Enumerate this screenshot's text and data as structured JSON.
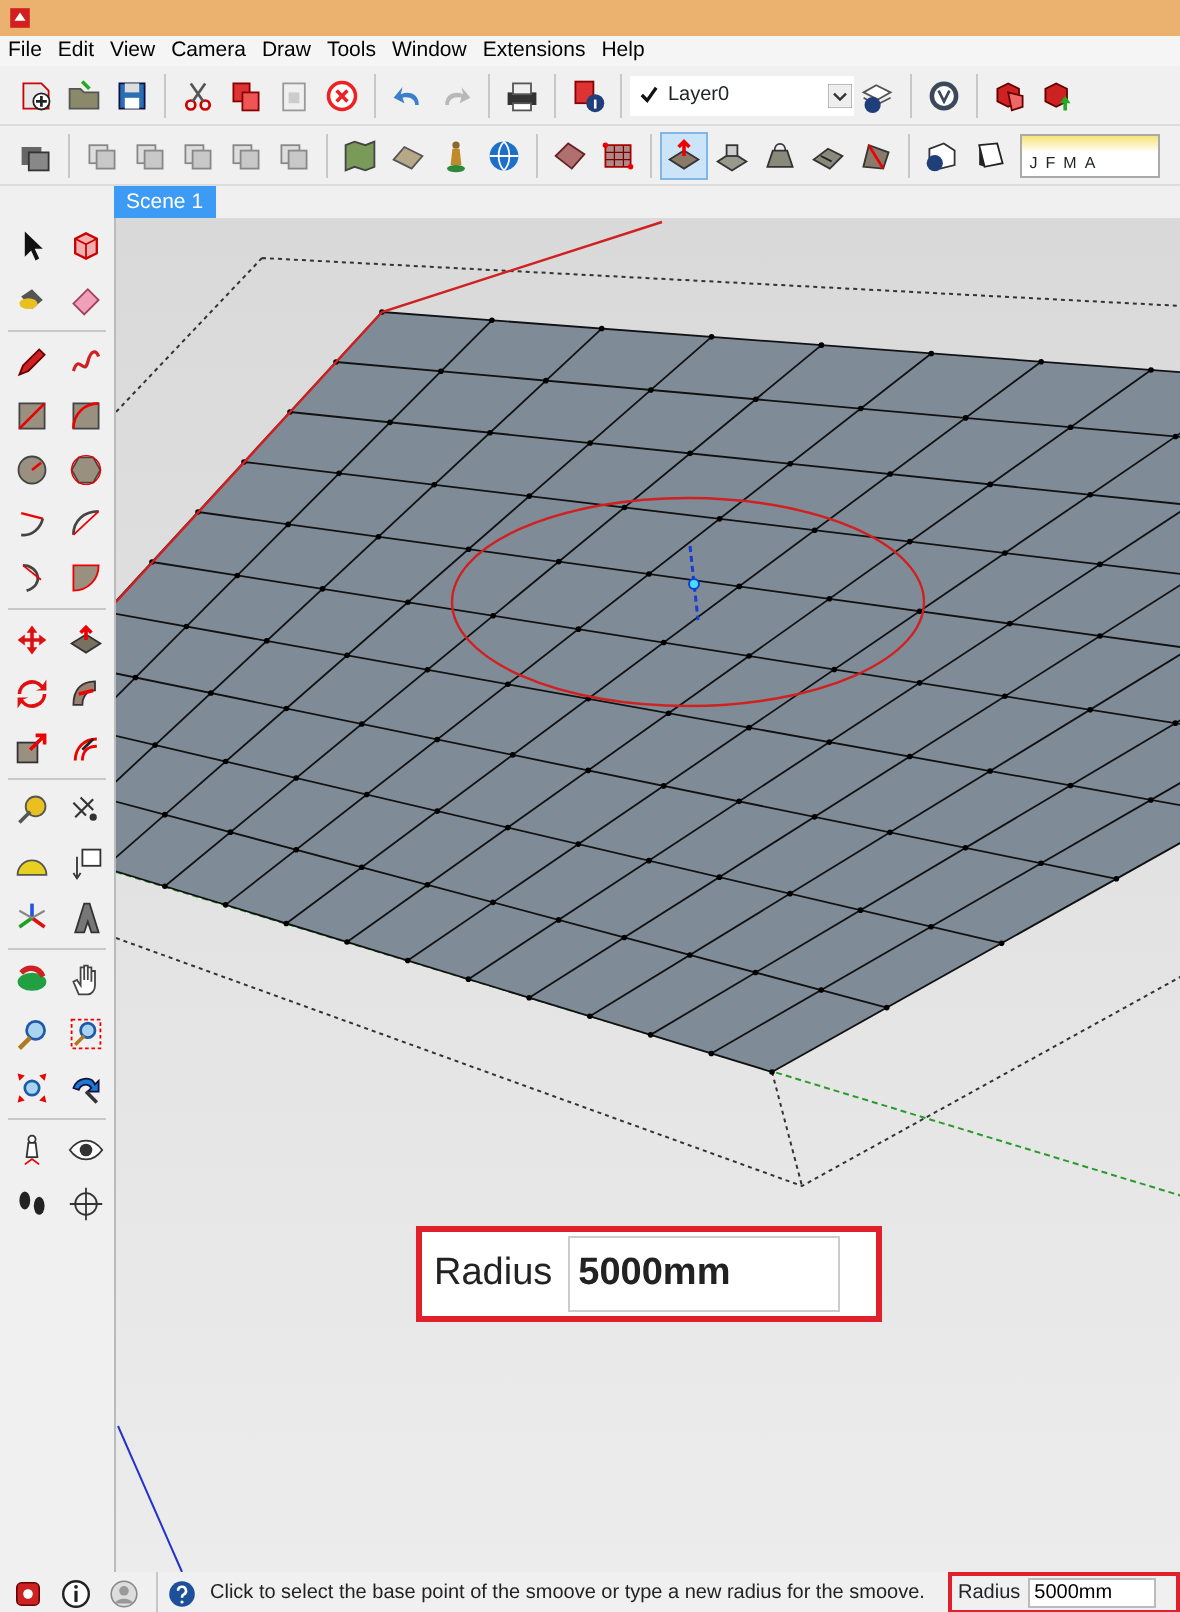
{
  "menu": [
    "File",
    "Edit",
    "View",
    "Camera",
    "Draw",
    "Tools",
    "Window",
    "Extensions",
    "Help"
  ],
  "layer_dropdown": {
    "value": "Layer0",
    "checked": true
  },
  "toolbar_2": [
    {
      "selected": false
    },
    {
      "selected": false
    },
    {
      "selected": false
    },
    {
      "selected": false
    },
    {
      "selected": false
    },
    {
      "selected": false
    },
    {
      "selected": false
    },
    {
      "selected": false
    },
    {
      "selected": false
    },
    {
      "selected": false
    },
    {
      "selected": false
    },
    {
      "selected": false
    },
    {
      "selected": true
    },
    {
      "selected": false
    },
    {
      "selected": false
    },
    {
      "selected": false
    },
    {
      "selected": false
    }
  ],
  "shadow_months": [
    "J",
    "F",
    "M",
    "A"
  ],
  "scene_tabs": [
    {
      "label": "Scene 1",
      "selected": true
    }
  ],
  "callout": {
    "label": "Radius",
    "value": "5000mm"
  },
  "status_bar": {
    "message": "Click to select the base point of the smoove or type a new radius for the smoove.",
    "measurement_label": "Radius",
    "measurement_value": "5000mm"
  }
}
